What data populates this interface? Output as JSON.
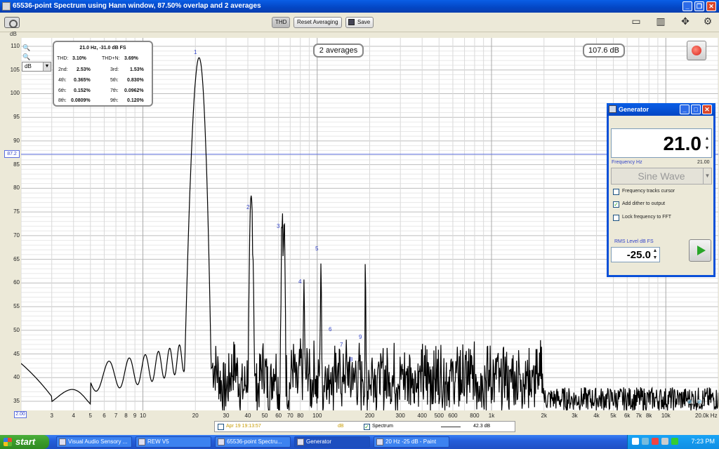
{
  "window": {
    "title": "65536-point Spectrum using Hann window, 87.50% overlap and 2 averages"
  },
  "toolbar": {
    "thd_label": "THD",
    "reset_label": "Reset Averaging",
    "save_label": "Save"
  },
  "plot": {
    "y_unit": "dB",
    "unit_select": "dB",
    "y_ticks": [
      "110",
      "105",
      "100",
      "95",
      "90",
      "85",
      "80",
      "75",
      "70",
      "65",
      "60",
      "55",
      "50",
      "45",
      "40",
      "35"
    ],
    "x_ticks": [
      "3",
      "4",
      "5",
      "6",
      "7",
      "8",
      "9",
      "10",
      "20",
      "30",
      "40",
      "50",
      "60",
      "70",
      "80",
      "100",
      "200",
      "300",
      "400",
      "500",
      "600",
      "800",
      "1k",
      "2k",
      "3k",
      "4k",
      "5k",
      "6k",
      "7k",
      "8k",
      "10k"
    ],
    "x_start": "2.00",
    "x_end": "20.0k Hz",
    "y_cursor": "87.2",
    "averages_badge": "2 averages",
    "level_badge": "107.6 dB",
    "peak_labels": [
      "1",
      "2",
      "3",
      "4",
      "5",
      "6",
      "7",
      "8",
      "9"
    ]
  },
  "thd": {
    "header": "21.0 Hz, -31.0 dB FS",
    "rows": [
      {
        "l1": "THD:",
        "v1": "3.10%",
        "l2": "THD+N:",
        "v2": "3.69%"
      },
      {
        "l1": "2nd:",
        "v1": "2.53%",
        "l2": "3rd:",
        "v2": "1.53%"
      },
      {
        "l1": "4th:",
        "v1": "0.365%",
        "l2": "5th:",
        "v2": "0.830%"
      },
      {
        "l1": "6th:",
        "v1": "0.152%",
        "l2": "7th:",
        "v2": "0.0962%"
      },
      {
        "l1": "8th:",
        "v1": "0.0809%",
        "l2": "9th:",
        "v2": "0.120%"
      }
    ]
  },
  "generator": {
    "title": "Generator",
    "frequency_value": "21.0",
    "frequency_label": "Frequency Hz",
    "frequency_readout": "21.00",
    "waveform": "Sine Wave",
    "chk_tracks": "Frequency tracks cursor",
    "chk_dither": "Add dither to output",
    "chk_lock": "Lock frequency to FFT",
    "level_label": "RMS Level dB FS",
    "level_value": "-25.0"
  },
  "legend": {
    "measurement": "Apr 19 19:13:57",
    "unit": "dB",
    "spectrum": "Spectrum",
    "value": "42.3 dB"
  },
  "taskbar": {
    "start": "start",
    "tasks": [
      "Visual Audio Sensory ...",
      "REW V5",
      "65536-point Spectru...",
      "Generator",
      "20 Hz -25 dB - Paint"
    ],
    "clock": "7:23 PM"
  }
}
